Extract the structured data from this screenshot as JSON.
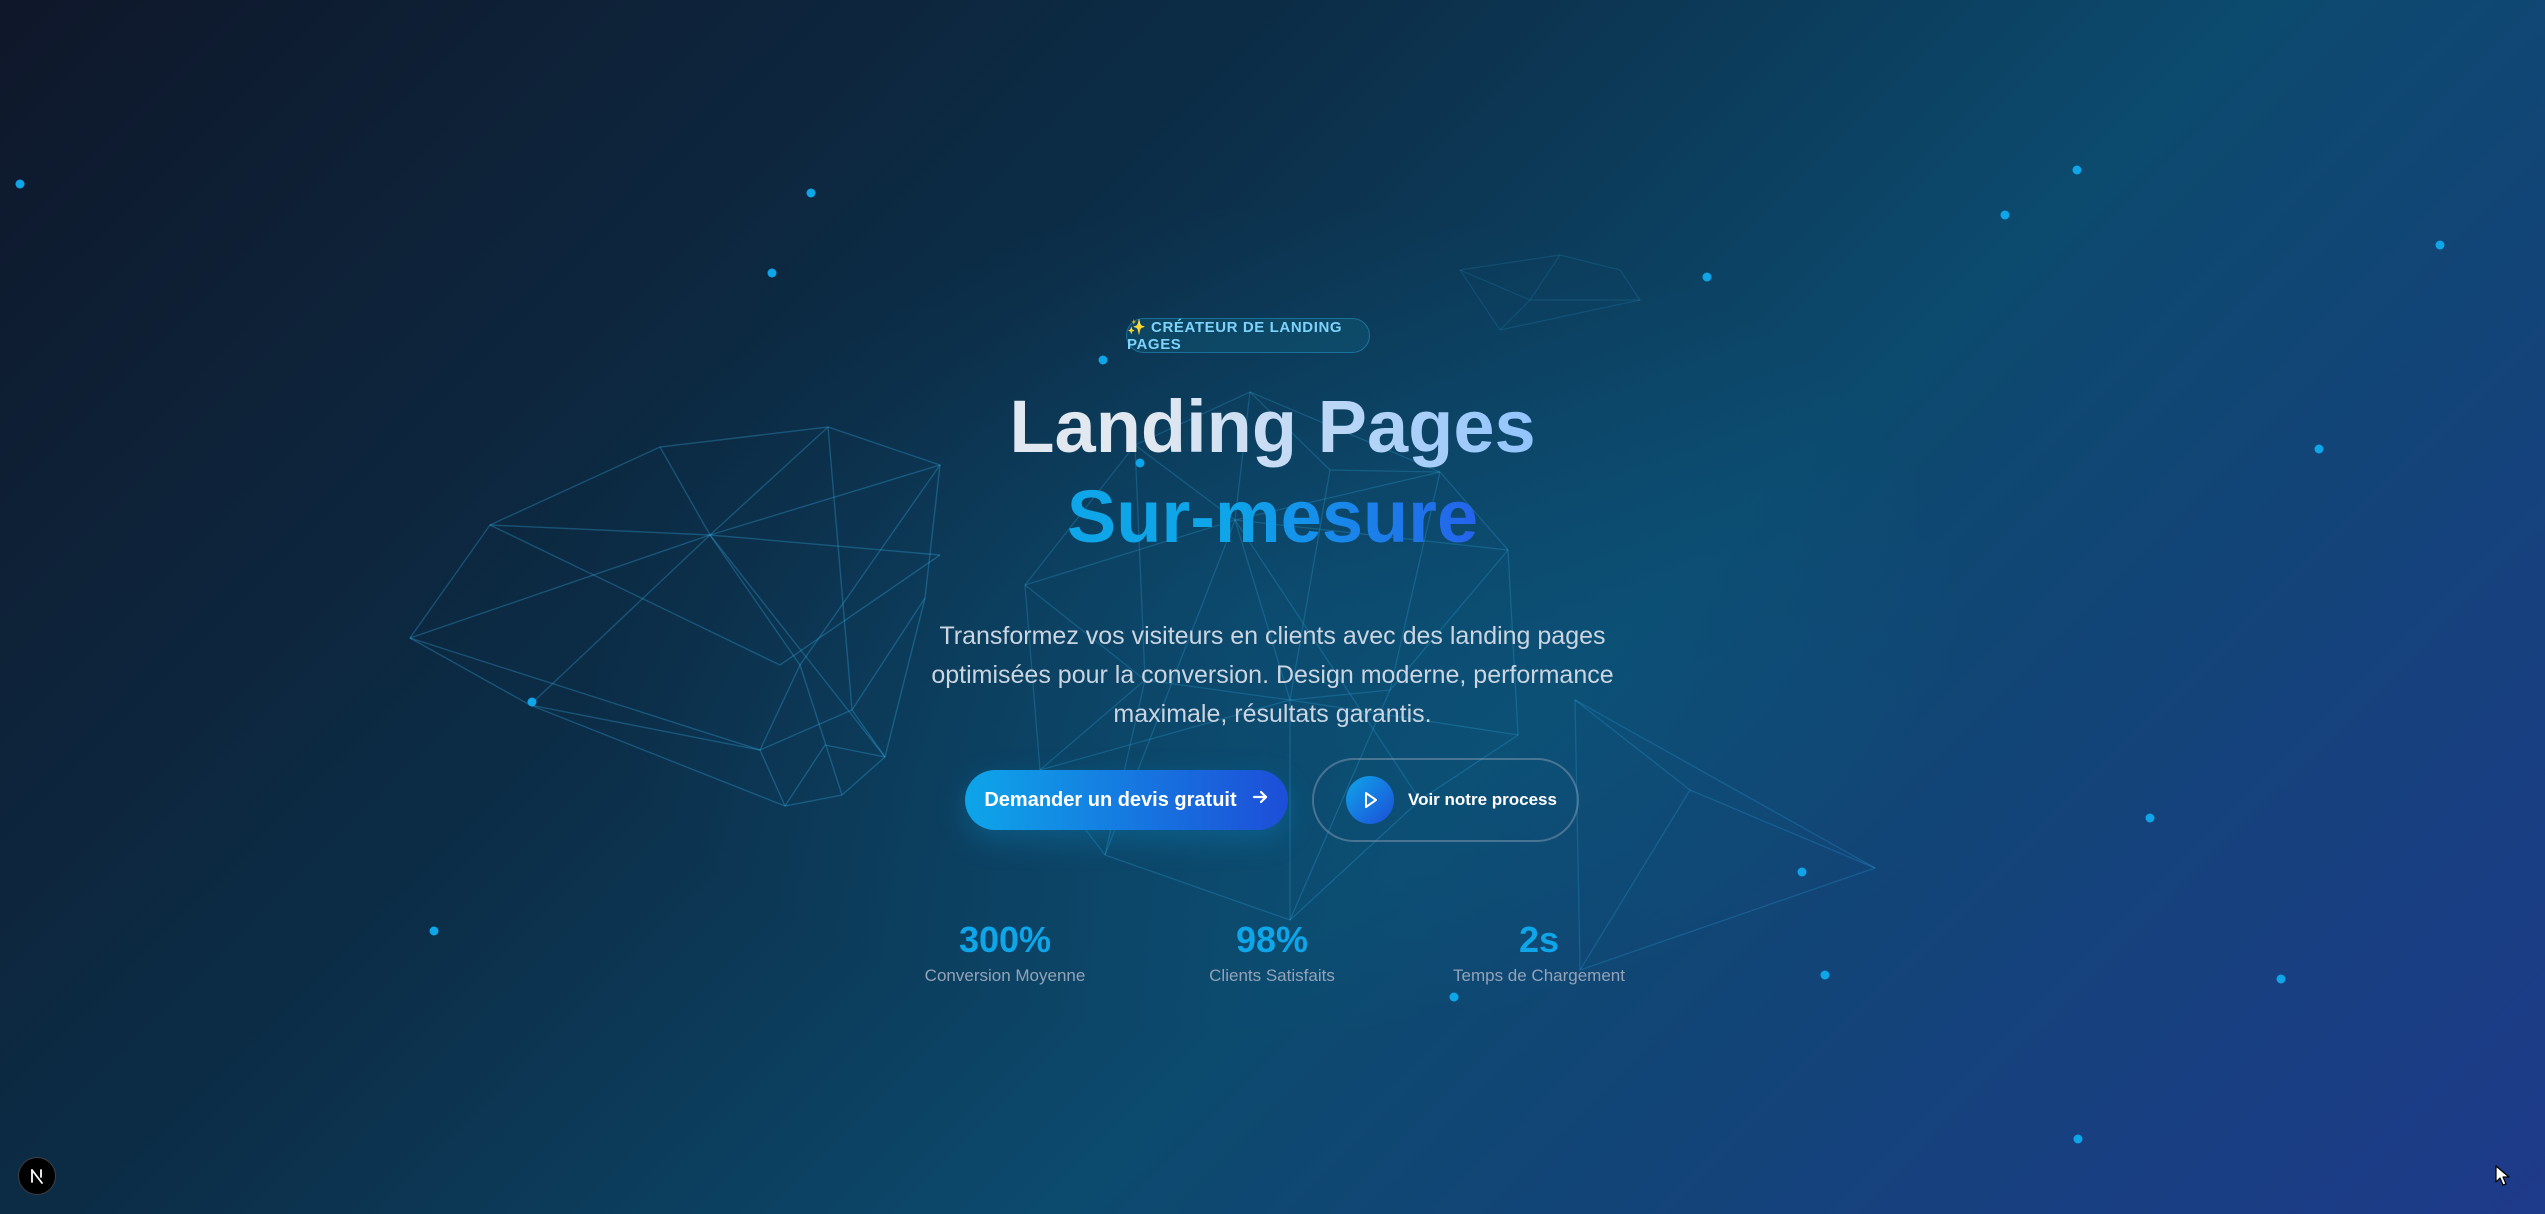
{
  "badge": {
    "icon": "sparkles-icon",
    "text": "✨ CRÉATEUR DE LANDING PAGES"
  },
  "hero": {
    "title_line1": "Landing Pages",
    "title_line2": "Sur-mesure",
    "subtitle": "Transformez vos visiteurs en clients avec des landing pages optimisées pour la conversion. Design moderne, performance maximale, résultats garantis."
  },
  "actions": {
    "primary_label": "Demander un devis gratuit",
    "primary_icon": "arrow-right-icon",
    "secondary_label": "Voir notre process",
    "secondary_icon": "play-icon"
  },
  "stats": [
    {
      "value": "300%",
      "label": "Conversion Moyenne"
    },
    {
      "value": "98%",
      "label": "Clients Satisfaits"
    },
    {
      "value": "2s",
      "label": "Temps de Chargement"
    }
  ],
  "colors": {
    "accent": "#0ea5e9",
    "accent_dark": "#1d4ed8",
    "background_start": "#0f172a",
    "background_end": "#1e3a8a"
  },
  "dev_indicator": {
    "icon": "nextjs-logo-icon"
  }
}
